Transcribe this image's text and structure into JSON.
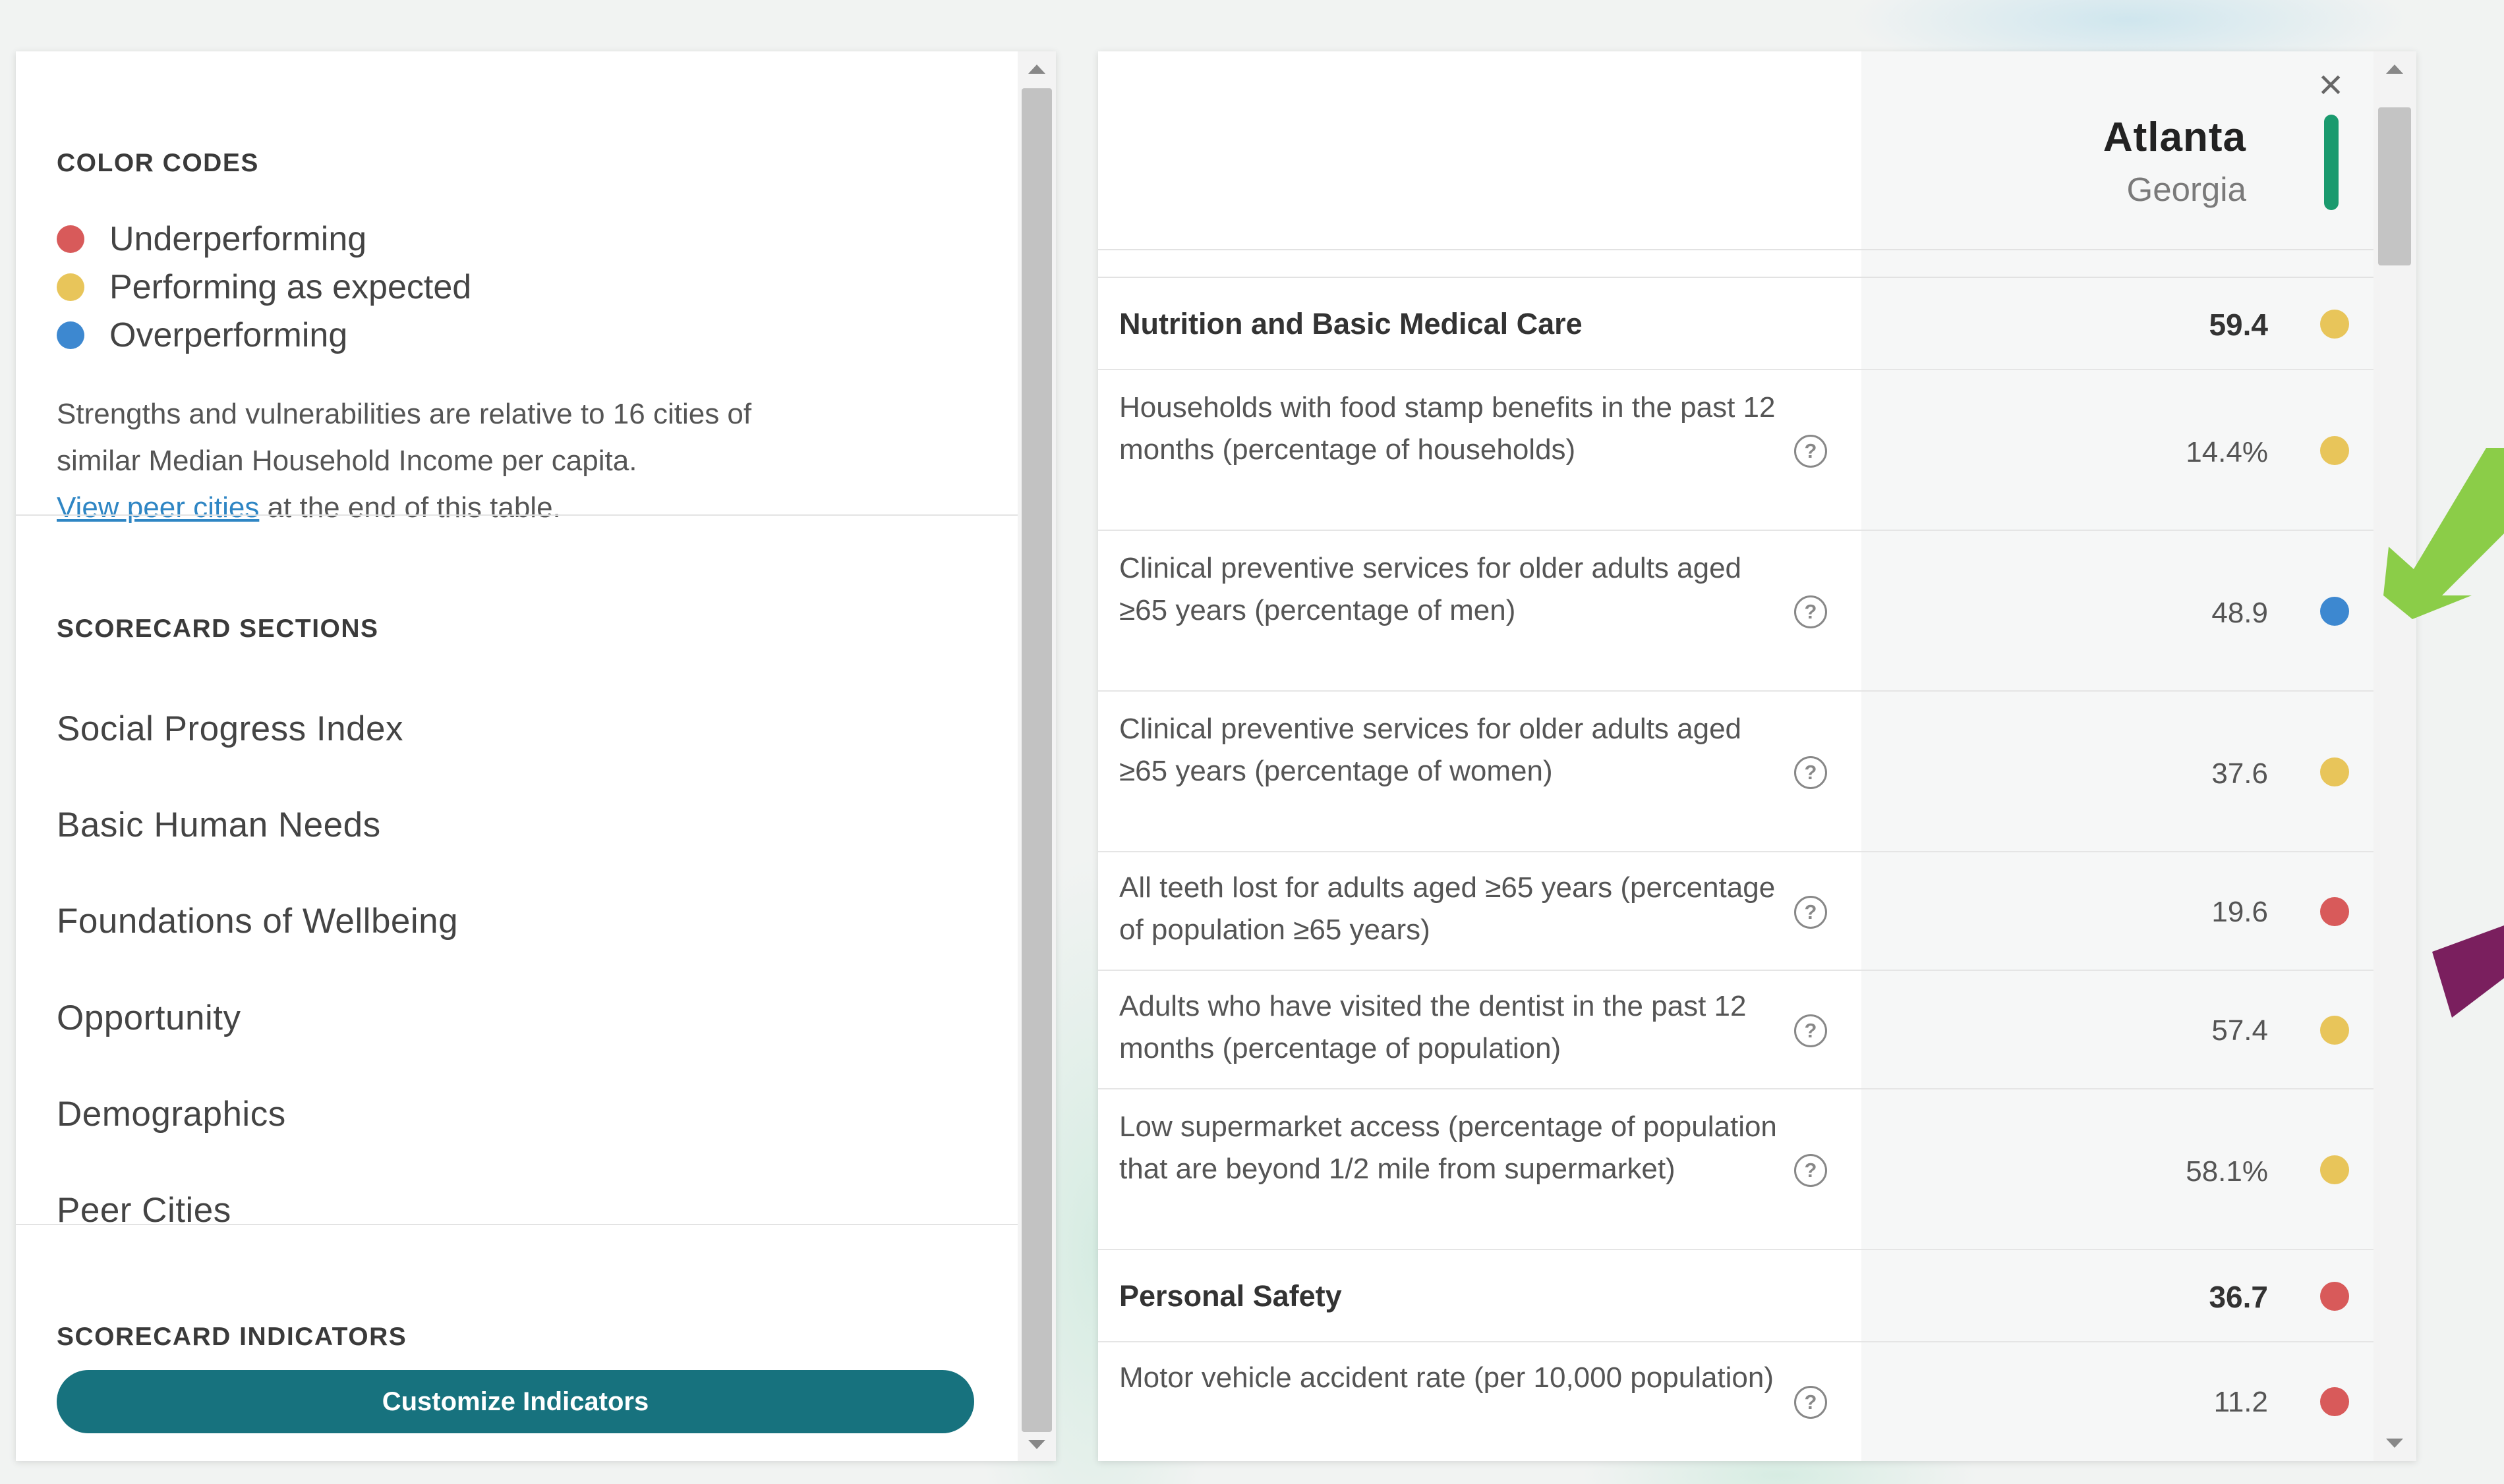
{
  "colors": {
    "underperforming": "#d85a5a",
    "expected": "#e8c55a",
    "overperforming": "#3d88d0",
    "button": "#17727e",
    "city_bar": "#1a9a6e",
    "link": "#2f86c4"
  },
  "left": {
    "color_codes_title": "COLOR CODES",
    "legend": [
      {
        "label": "Underperforming",
        "status": "under"
      },
      {
        "label": "Performing as expected",
        "status": "expected"
      },
      {
        "label": "Overperforming",
        "status": "over"
      }
    ],
    "note_line1": "Strengths and vulnerabilities are relative to 16 cities of",
    "note_line2": "similar Median Household Income per capita.",
    "note_link": "View peer cities",
    "note_tail": " at the end of this table.",
    "sections_title": "SCORECARD SECTIONS",
    "sections": [
      "Social Progress Index",
      "Basic Human Needs",
      "Foundations of Wellbeing",
      "Opportunity",
      "Demographics",
      "Peer Cities"
    ],
    "indicators_title": "SCORECARD INDICATORS",
    "customize_button": "Customize Indicators"
  },
  "right": {
    "city": "Atlanta",
    "state": "Georgia",
    "close_icon": "close-icon",
    "rows": [
      {
        "type": "category",
        "label": "Nutrition and Basic Medical Care",
        "value": "59.4",
        "status": "expected"
      },
      {
        "type": "indicator",
        "label": "Households with food stamp benefits in the past 12 months (percentage of households)",
        "value": "14.4%",
        "status": "expected"
      },
      {
        "type": "indicator",
        "label": "Clinical preventive services for older adults aged ≥65 years (percentage of men)",
        "value": "48.9",
        "status": "over"
      },
      {
        "type": "indicator",
        "label": "Clinical preventive services for older adults aged ≥65 years (percentage of women)",
        "value": "37.6",
        "status": "expected"
      },
      {
        "type": "indicator",
        "label": "All teeth lost for adults aged ≥65 years (percentage of population ≥65 years)",
        "value": "19.6",
        "status": "under"
      },
      {
        "type": "indicator",
        "label": "Adults who have visited the dentist in the past 12 months (percentage of population)",
        "value": "57.4",
        "status": "expected"
      },
      {
        "type": "indicator",
        "label": "Low supermarket access (percentage of population that are beyond 1/2 mile from supermarket)",
        "value": "58.1%",
        "status": "expected"
      },
      {
        "type": "category",
        "label": "Personal Safety",
        "value": "36.7",
        "status": "under"
      },
      {
        "type": "indicator",
        "label": "Motor vehicle accident rate (per 10,000 population)",
        "value": "11.2",
        "status": "under"
      }
    ]
  }
}
